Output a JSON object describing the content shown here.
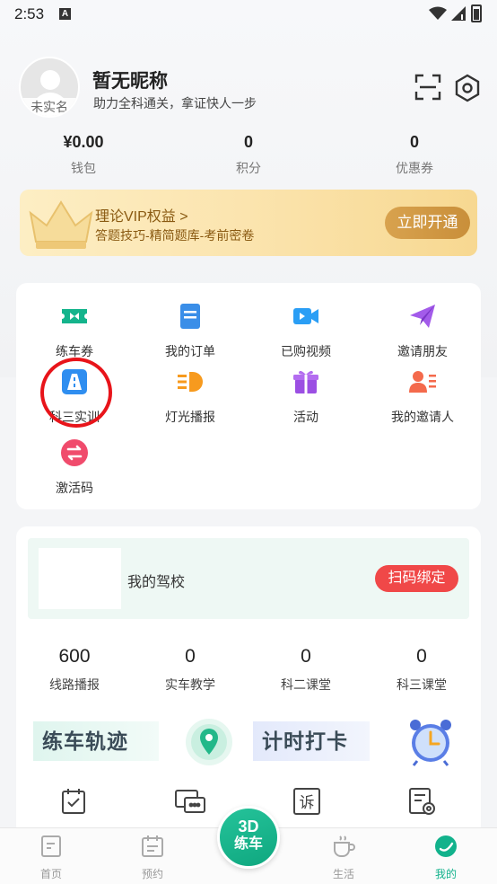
{
  "status_bar": {
    "time": "2:53",
    "notification_glyph": "A"
  },
  "profile": {
    "nickname": "暂无昵称",
    "slogan": "助力全科通关，拿证快人一步",
    "avatar_tag": "未实名"
  },
  "stats": [
    {
      "value": "¥0.00",
      "label": "钱包"
    },
    {
      "value": "0",
      "label": "积分"
    },
    {
      "value": "0",
      "label": "优惠券"
    }
  ],
  "vip": {
    "title": "理论VIP权益  >",
    "subtitle": "答题技巧-精简题库-考前密卷",
    "button": "立即开通"
  },
  "grid": [
    {
      "label": "练车券",
      "icon": "ticket-icon"
    },
    {
      "label": "我的订单",
      "icon": "order-icon"
    },
    {
      "label": "已购视频",
      "icon": "video-icon"
    },
    {
      "label": "邀请朋友",
      "icon": "paper-plane-icon"
    },
    {
      "label": "科三实训",
      "icon": "road-icon"
    },
    {
      "label": "灯光播报",
      "icon": "headlight-icon"
    },
    {
      "label": "活动",
      "icon": "gift-icon"
    },
    {
      "label": "我的邀请人",
      "icon": "inviter-icon"
    },
    {
      "label": "激活码",
      "icon": "swap-icon"
    }
  ],
  "school": {
    "name": "我的驾校",
    "bind_button": "扫码绑定",
    "stats": [
      {
        "value": "600",
        "label": "线路播报"
      },
      {
        "value": "0",
        "label": "实车教学"
      },
      {
        "value": "0",
        "label": "科二课堂"
      },
      {
        "value": "0",
        "label": "科三课堂"
      }
    ],
    "feature_left": "练车轨迹",
    "feature_right": "计时打卡"
  },
  "tabbar": {
    "tabs": [
      {
        "label": "首页"
      },
      {
        "label": "预约"
      },
      {
        "label": "生活"
      },
      {
        "label": "我的"
      }
    ],
    "center_line1": "3D",
    "center_line2": "练车"
  },
  "colors": {
    "accent": "#12b28c",
    "danger": "#f04848",
    "vip_gold": "#c98f3a"
  }
}
